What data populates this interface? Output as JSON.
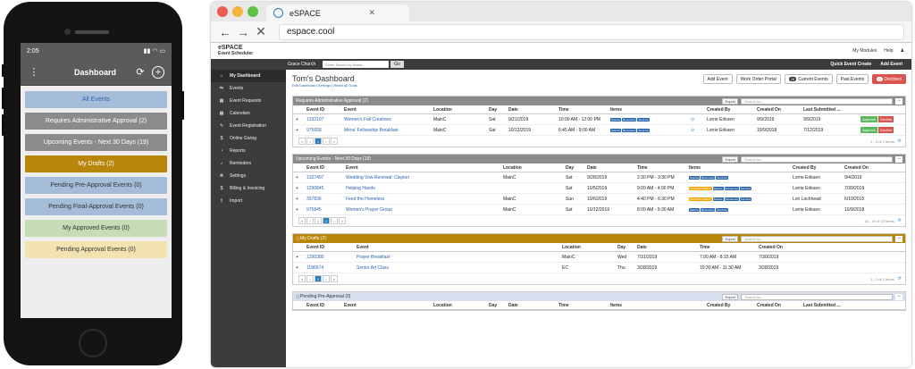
{
  "mobile": {
    "time": "2:05",
    "title": "Dashboard",
    "items": [
      {
        "label": "All Events",
        "bg": "#a6bdd9",
        "color": "#2a65b0"
      },
      {
        "label": "Requires Administrative Approval (2)",
        "bg": "#8b8b8b",
        "color": "#ffffff"
      },
      {
        "label": "Upcoming Events - Next 30 Days (19)",
        "bg": "#8b8b8b",
        "color": "#ffffff"
      },
      {
        "label": "My Drafts (2)",
        "bg": "#b8860b",
        "color": "#ffffff"
      },
      {
        "label": "Pending Pre-Approval Events (0)",
        "bg": "#a6bdd9",
        "color": "#333333"
      },
      {
        "label": "Pending Final-Approval Events (0)",
        "bg": "#a6bdd9",
        "color": "#333333"
      },
      {
        "label": "My Approved Events (0)",
        "bg": "#c5dcb6",
        "color": "#333333"
      },
      {
        "label": "Pending Approval Events (0)",
        "bg": "#f3e3b0",
        "color": "#333333"
      }
    ]
  },
  "browser": {
    "tab_title": "eSPACE",
    "url": "espace.cool"
  },
  "app": {
    "logo": "eSPACE",
    "logo_sub": "Event Scheduler",
    "top_links": [
      "My Modules",
      "Help"
    ],
    "org": "Grace Church",
    "search_placeholder": "Event Search by Name...",
    "go": "Go",
    "quick_create": "Quick Event Create",
    "add_event_top": "Add Event",
    "sidebar": [
      "My Dashboard",
      "Events",
      "Event Requests",
      "Calendars",
      "Event Registration",
      "Online Giving",
      "Reports",
      "Reminders",
      "Settings",
      "Billing & Invoicing",
      "Import"
    ]
  },
  "dashboard": {
    "title": "Tom's Dashboard",
    "sub": "Edit Dashboard Settings | Reset All Grids",
    "buttons": {
      "add": "Add Event",
      "wo": "Work Order Portal",
      "current_count": "28",
      "current": "Current Events",
      "past": "Past Events",
      "declined_count": "0",
      "declined": "Declined"
    }
  },
  "panels": {
    "approval": {
      "title": "Requires Administrative Approval (2)",
      "headers": [
        "",
        "Event ID",
        "Event",
        "Location",
        "Day",
        "Date",
        "Time",
        "Items",
        "",
        "Created By",
        "Created On",
        "Last Submitted ...",
        ""
      ],
      "rows": [
        [
          "+",
          "1332107",
          "Women's Fall Creations",
          "MainC",
          "Sat",
          "9/21/2019",
          "10:00 AM - 12:00 PM",
          "Lorrie Eriksen",
          "9/9/2019",
          "9/9/2019"
        ],
        [
          "+",
          "975658",
          "Mens' Fellowship Breakfast",
          "MainC",
          "Sat",
          "10/12/2019",
          "6:45 AM - 9:00 AM",
          "Lorrie Eriksen",
          "10/9/2018",
          "7/12/2019"
        ]
      ],
      "footer": "1 - 2 of 2 Items",
      "page": "1"
    },
    "upcoming": {
      "title": "Upcoming Events - Next 30 Days (19)",
      "headers": [
        "",
        "Event ID",
        "Event",
        "Location",
        "Day",
        "Date",
        "Time",
        "Items",
        "Created By",
        "Created On"
      ],
      "rows": [
        [
          "+",
          "1327497",
          "Wedding Vow Renewal: Clayton",
          "MainC",
          "Sat",
          "9/28/2019",
          "2:30 PM - 3:30 PM",
          "Lorrie Eriksen",
          "9/4/2019"
        ],
        [
          "+",
          "1290845",
          "Helping Hands",
          "",
          "Sat",
          "10/5/2019",
          "9:00 AM - 4:00 PM",
          "Lorrie Eriksen",
          "7/30/2019"
        ],
        [
          "+",
          "337836",
          "Feed the Homeless",
          "MainC",
          "Sun",
          "10/6/2019",
          "4:40 PM - 6:30 PM",
          "Lori Lochhead",
          "6/10/2015"
        ],
        [
          "+",
          "975845",
          "Women's Prayer Group",
          "MainC",
          "Sat",
          "10/12/2019",
          "8:00 AM - 9:30 AM",
          "Lorrie Eriksen",
          "10/9/2018"
        ]
      ],
      "footer": "16 - 19 of 19 Items",
      "page": "2"
    },
    "drafts": {
      "title": "My Drafts (2)",
      "headers": [
        "",
        "Event ID",
        "Event",
        "Location",
        "Day",
        "Date",
        "Time",
        "Created On"
      ],
      "rows": [
        [
          "+",
          "1290380",
          "Prayer Breakfast",
          "MainC",
          "Wed",
          "7/31/2019",
          "7:00 AM - 8:15 AM",
          "7/30/2019"
        ],
        [
          "+",
          "1186674",
          "Senior Art Class",
          "EC",
          "Thu",
          "3/28/2019",
          "10:30 AM - 11:30 AM",
          "3/28/2019"
        ]
      ],
      "footer": "1 - 2 of 2 Items",
      "page": "1"
    },
    "preapproval": {
      "title": "Pending Pre-Approval (0)",
      "headers": [
        "",
        "Event ID",
        "Event",
        "Location",
        "Day",
        "Date",
        "Time",
        "Items",
        "",
        "Created By",
        "Created On",
        "Last Submitted ..."
      ]
    }
  },
  "labels": {
    "export": "Export",
    "search": "Search for...",
    "spaces": "Spaces",
    "resources": "Resources",
    "services": "Services",
    "offsite": "OFFSITE EVENT",
    "approve": "Approve",
    "decline": "Decline"
  },
  "colors": {
    "gray": "#8b8b8b",
    "gold": "#b8860b",
    "blue": "#d6e0ee",
    "link": "#2a65b0"
  }
}
